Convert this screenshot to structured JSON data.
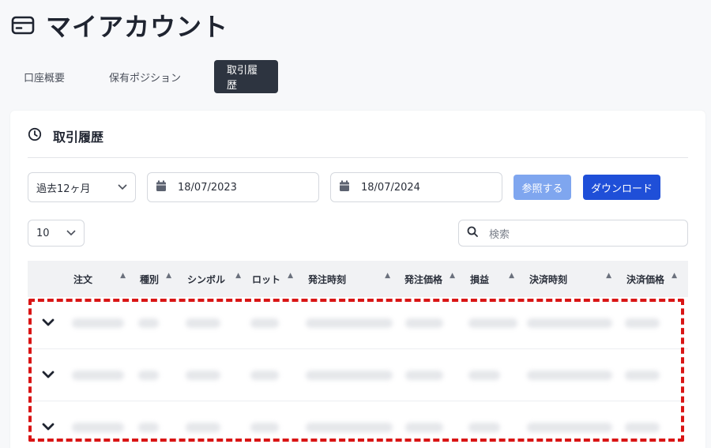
{
  "header": {
    "title": "マイアカウント",
    "icon": "card-icon"
  },
  "tabs": [
    {
      "label": "口座概要"
    },
    {
      "label": "保有ポジション"
    },
    {
      "label": "取引履歴",
      "active": true
    }
  ],
  "card": {
    "title": "取引履歴",
    "icon": "clock-icon",
    "filters": {
      "period": "過去12ヶ月",
      "date_from": "18/07/2023",
      "date_to": "18/07/2024",
      "search_button": "参照する",
      "download_button": "ダウンロード"
    },
    "page_size": "10",
    "search_placeholder": "検索"
  },
  "table": {
    "columns": [
      "注文",
      "種別",
      "シンボル",
      "ロット",
      "発注時刻",
      "発注価格",
      "損益",
      "決済時刻",
      "決済価格"
    ]
  },
  "colors": {
    "accent": "#1f4fd8",
    "accent_light": "#7fa6ef",
    "active_tab": "#2d3440",
    "highlight": "#d91515"
  }
}
